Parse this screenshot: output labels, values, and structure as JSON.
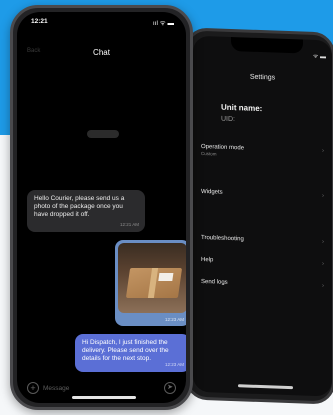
{
  "colors": {
    "accent_blue": "#1e9be8",
    "outgoing_bubble": "#5b6fd6",
    "photo_bubble": "#6a8ec4",
    "incoming_bubble": "#2b2b2d"
  },
  "chat_phone": {
    "status": {
      "time": "12:21",
      "icons": "ııl ᯤ ▬"
    },
    "header": {
      "back_label": "Back",
      "title": "Chat"
    },
    "messages": [
      {
        "direction": "incoming",
        "text": "Hello Courier, please send us a photo of the package once you have dropped it off.",
        "time": "12:21 AM"
      },
      {
        "direction": "outgoing",
        "type": "photo",
        "time": "12:23 AM"
      },
      {
        "direction": "outgoing",
        "text": "Hi Dispatch, I just finished the delivery. Please send over the details for the next stop.",
        "time": "12:23 AM"
      }
    ],
    "composer": {
      "placeholder": "Message",
      "attach_icon": "plus-circle-icon",
      "send_icon": "send-circle-icon"
    }
  },
  "settings_phone": {
    "status": {
      "time": "",
      "icons": "ᯤ ▬"
    },
    "title": "Settings",
    "unit_name_label": "Unit name:",
    "uid_label": "UID:",
    "items": [
      {
        "label": "Operation mode",
        "sub": "Custom"
      },
      {
        "label": "Widgets",
        "sub": ""
      },
      {
        "label": "Troubleshooting",
        "sub": ""
      },
      {
        "label": "Help",
        "sub": ""
      },
      {
        "label": "Send logs",
        "sub": ""
      }
    ]
  }
}
